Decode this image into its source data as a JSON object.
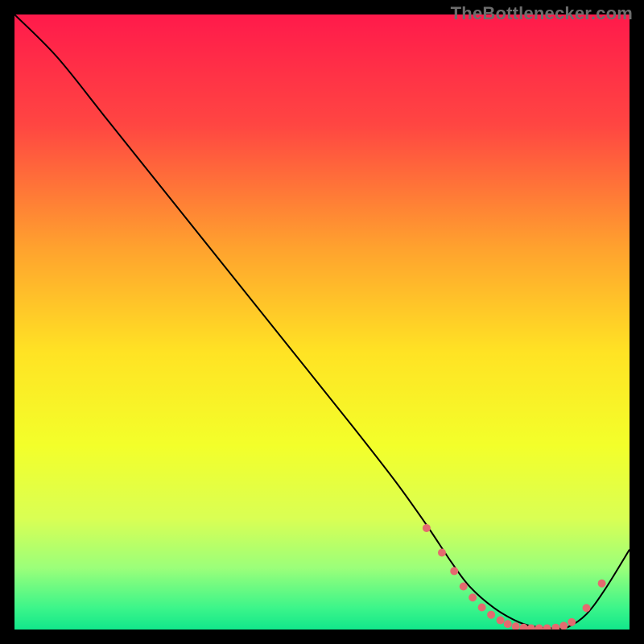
{
  "watermark": "TheBottlenecker.com",
  "chart_data": {
    "type": "line",
    "title": "",
    "xlabel": "",
    "ylabel": "",
    "xlim": [
      0,
      100
    ],
    "ylim": [
      0,
      100
    ],
    "background": {
      "type": "vertical-gradient",
      "stops": [
        {
          "offset": 0.0,
          "color": "#ff1a4b"
        },
        {
          "offset": 0.18,
          "color": "#ff4642"
        },
        {
          "offset": 0.38,
          "color": "#ffa22e"
        },
        {
          "offset": 0.55,
          "color": "#ffe324"
        },
        {
          "offset": 0.7,
          "color": "#f3ff2a"
        },
        {
          "offset": 0.82,
          "color": "#d9ff54"
        },
        {
          "offset": 0.9,
          "color": "#9bff7a"
        },
        {
          "offset": 0.965,
          "color": "#3cf58a"
        },
        {
          "offset": 1.0,
          "color": "#12e78b"
        }
      ]
    },
    "series": [
      {
        "name": "bottleneck-curve",
        "color": "#000000",
        "width": 2.0,
        "x": [
          0,
          7,
          15,
          25,
          35,
          45,
          55,
          62,
          67,
          71,
          74,
          78,
          82,
          85,
          88,
          90,
          93,
          96,
          100
        ],
        "y": [
          100,
          93,
          83,
          70.5,
          58,
          45.5,
          33,
          24,
          17,
          11,
          7,
          3.5,
          1.2,
          0.4,
          0.2,
          0.4,
          2.5,
          6.5,
          13
        ]
      }
    ],
    "markers": {
      "name": "valley-dots",
      "color": "#e46a6f",
      "radius": 5,
      "points": [
        {
          "x": 67.0,
          "y": 16.5
        },
        {
          "x": 69.5,
          "y": 12.5
        },
        {
          "x": 71.5,
          "y": 9.5
        },
        {
          "x": 73.0,
          "y": 7.0
        },
        {
          "x": 74.5,
          "y": 5.2
        },
        {
          "x": 76.0,
          "y": 3.6
        },
        {
          "x": 77.5,
          "y": 2.4
        },
        {
          "x": 79.0,
          "y": 1.5
        },
        {
          "x": 80.2,
          "y": 0.9
        },
        {
          "x": 81.5,
          "y": 0.5
        },
        {
          "x": 82.8,
          "y": 0.3
        },
        {
          "x": 84.0,
          "y": 0.2
        },
        {
          "x": 85.3,
          "y": 0.2
        },
        {
          "x": 86.6,
          "y": 0.2
        },
        {
          "x": 88.0,
          "y": 0.3
        },
        {
          "x": 89.3,
          "y": 0.6
        },
        {
          "x": 90.6,
          "y": 1.2
        },
        {
          "x": 93.0,
          "y": 3.5
        },
        {
          "x": 95.5,
          "y": 7.5
        }
      ]
    }
  }
}
